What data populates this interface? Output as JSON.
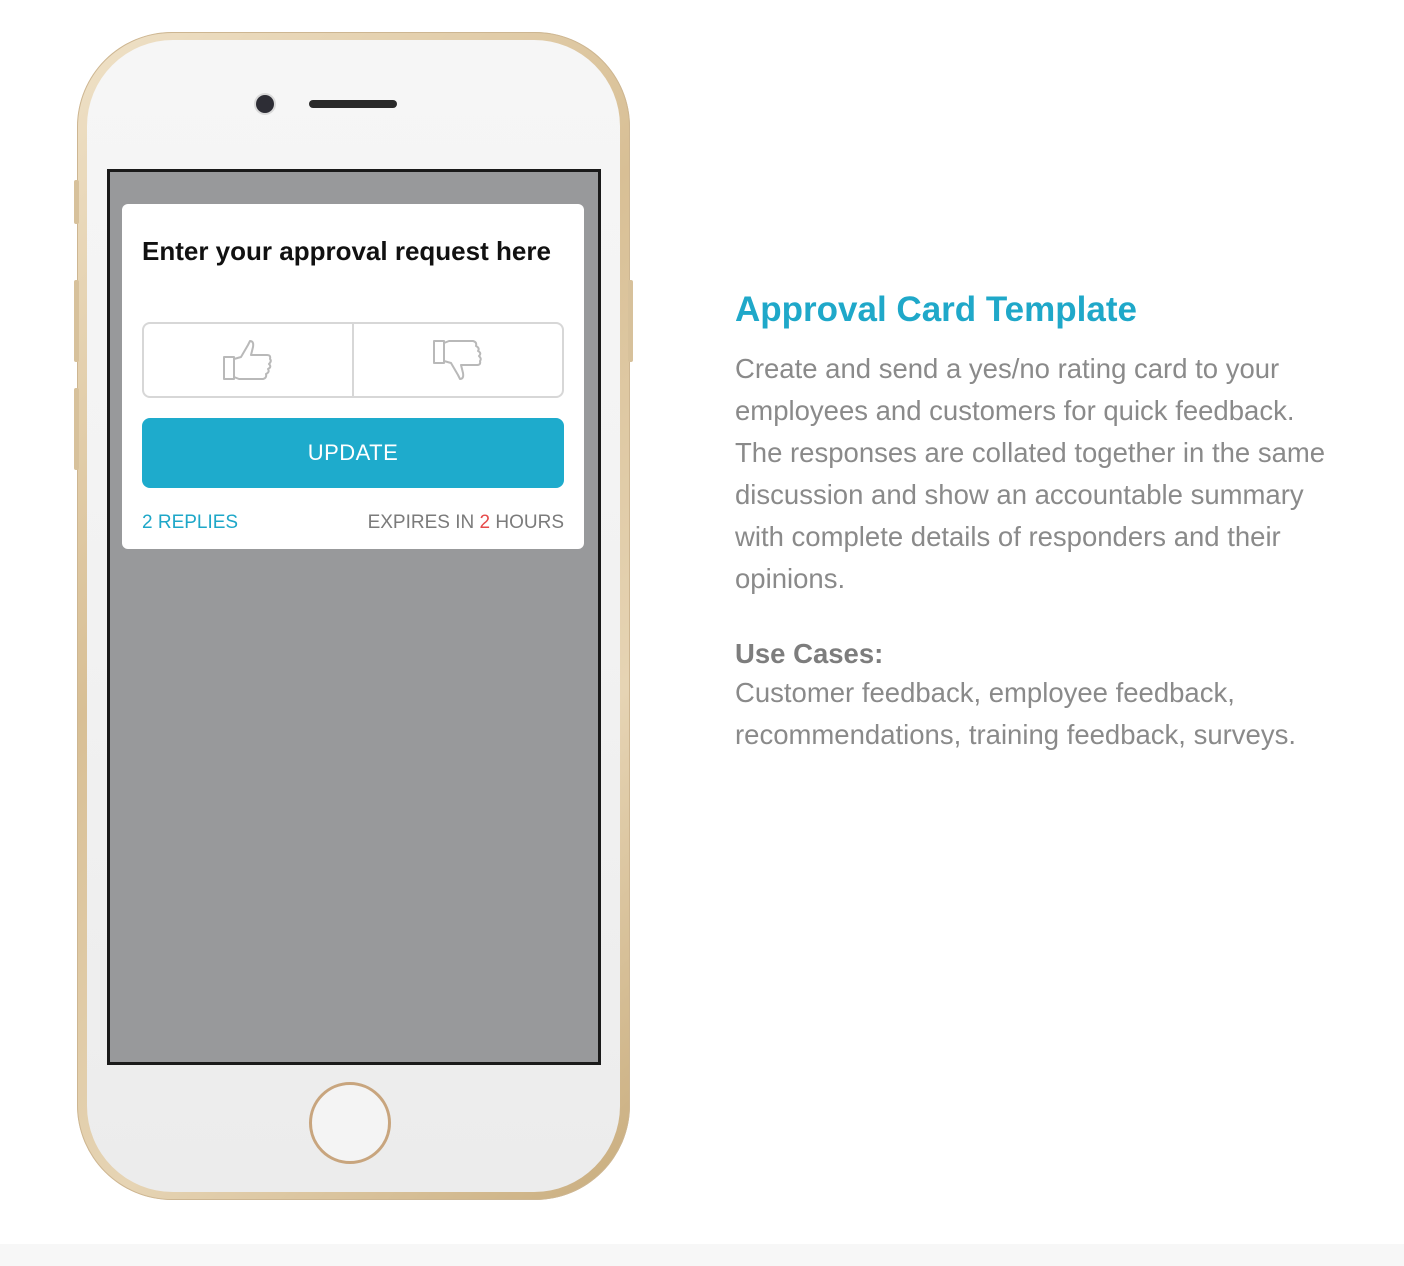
{
  "card": {
    "title": "Enter your approval request here",
    "update_label": "UPDATE",
    "replies": "2 REPLIES",
    "expires_prefix": "EXPIRES IN",
    "expires_value": "2",
    "expires_suffix": "HOURS",
    "vote_icons": [
      "thumbs-up-icon",
      "thumbs-down-icon"
    ]
  },
  "description": {
    "title": "Approval Card Template",
    "body": "Create and send a yes/no rating card to your employees and customers for quick feedback. The responses are collated together in the same discussion and show an accountable summary with complete details of responders and their opinions.",
    "use_cases_title": "Use Cases:",
    "use_cases_body": "Customer feedback, employee feedback, recommendations, training feedback, surveys."
  },
  "colors": {
    "accent": "#1eabcc",
    "screen_bg": "#98999b",
    "expires_highlight": "#e64b4b",
    "phone_frame": "#d8bf95"
  }
}
